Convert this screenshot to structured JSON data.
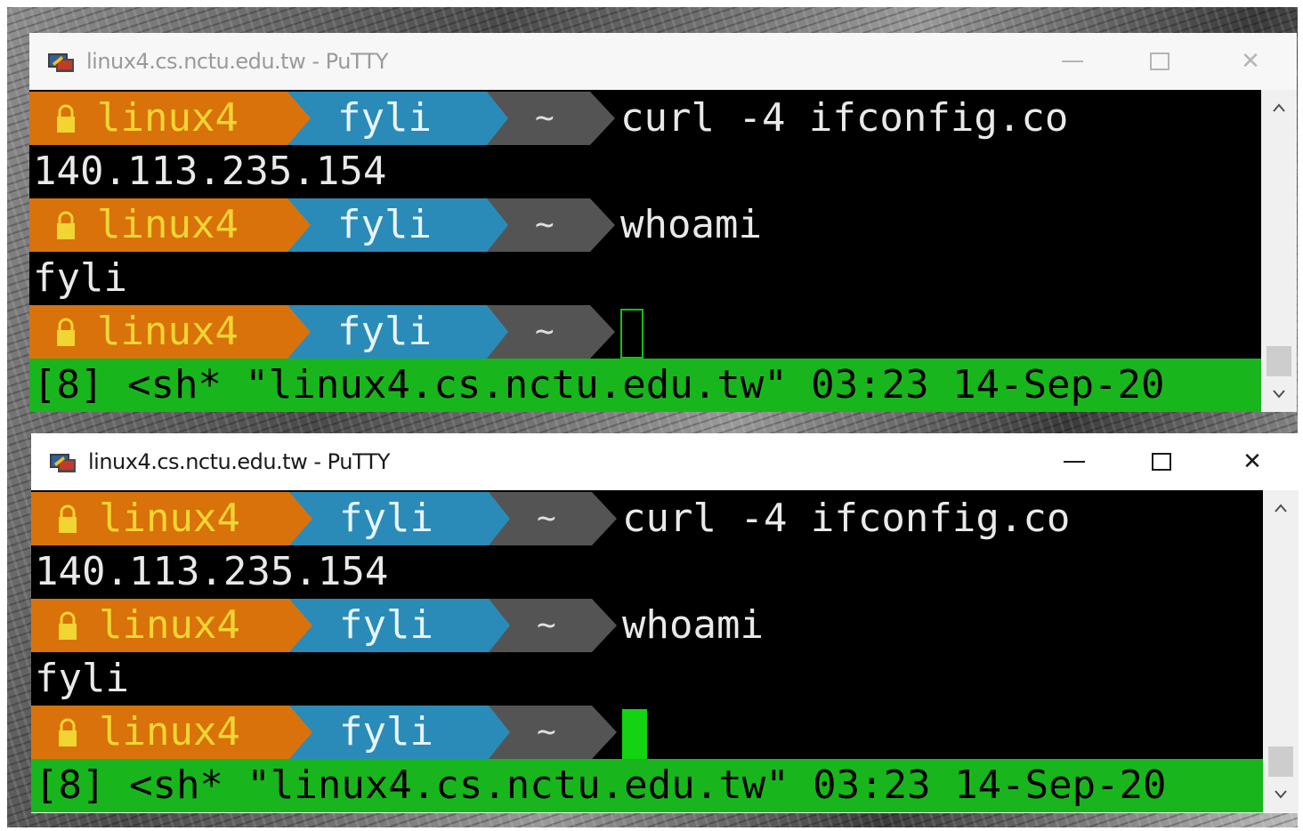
{
  "windows": [
    {
      "title": "linux4.cs.nctu.edu.tw - PuTTY",
      "controls": {
        "minimize": "—",
        "maximize": "□",
        "close": "✕"
      },
      "prompt": {
        "lock": "🔒",
        "host": "linux4",
        "user": "fyli",
        "dir": "~"
      },
      "lines": [
        {
          "command": "curl -4 ifconfig.co"
        },
        {
          "output": "140.113.235.154"
        },
        {
          "command": "whoami"
        },
        {
          "output": "fyli"
        },
        {
          "command": ""
        }
      ],
      "cursor_style": "hollow",
      "statusbar": "[8] <sh* \"linux4.cs.nctu.edu.tw\" 03:23 14-Sep-20",
      "scroll": {
        "up": "^",
        "down": "v"
      }
    },
    {
      "title": "linux4.cs.nctu.edu.tw - PuTTY",
      "controls": {
        "minimize": "—",
        "maximize": "□",
        "close": "✕"
      },
      "prompt": {
        "lock": "🔒",
        "host": "linux4",
        "user": "fyli",
        "dir": "~"
      },
      "lines": [
        {
          "command": "curl -4 ifconfig.co"
        },
        {
          "output": "140.113.235.154"
        },
        {
          "command": "whoami"
        },
        {
          "output": "fyli"
        },
        {
          "command": ""
        }
      ],
      "cursor_style": "solid",
      "statusbar": "[8] <sh* \"linux4.cs.nctu.edu.tw\" 03:23 14-Sep-20",
      "scroll": {
        "up": "^",
        "down": "v"
      }
    }
  ],
  "colors": {
    "host_bg": "#d9720b",
    "host_fg": "#f1d533",
    "user_bg": "#2a8bb8",
    "dir_bg": "#545454",
    "statusbar_bg": "#18b61c",
    "cursor": "#13d313",
    "terminal_bg": "#000000"
  },
  "icons": {
    "app": "putty-icon",
    "lock": "lock-icon"
  }
}
